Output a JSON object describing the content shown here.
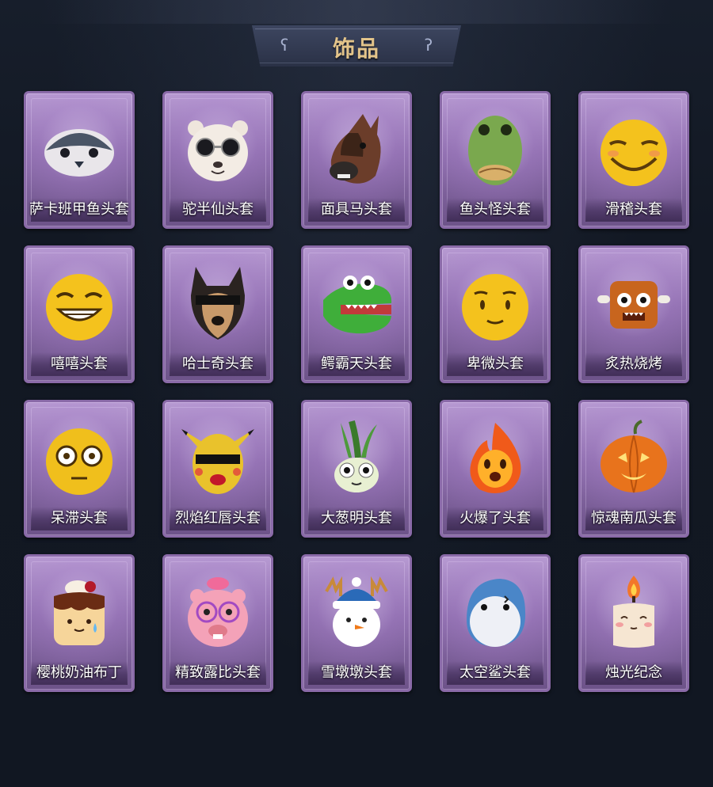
{
  "header": {
    "title": "饰品"
  },
  "items": [
    {
      "label": "萨卡班甲鱼头套",
      "icon": "fish-head-mask-icon"
    },
    {
      "label": "驼半仙头套",
      "icon": "alpaca-sunglasses-mask-icon"
    },
    {
      "label": "面具马头套",
      "icon": "horse-head-mask-icon"
    },
    {
      "label": "鱼头怪头套",
      "icon": "green-fish-head-mask-icon"
    },
    {
      "label": "滑稽头套",
      "icon": "funny-face-mask-icon"
    },
    {
      "label": "嘻嘻头套",
      "icon": "grinning-face-mask-icon"
    },
    {
      "label": "哈士奇头套",
      "icon": "husky-mask-icon"
    },
    {
      "label": "鳄霸天头套",
      "icon": "crocodile-mask-icon"
    },
    {
      "label": "卑微头套",
      "icon": "humble-face-mask-icon"
    },
    {
      "label": "炙热烧烤",
      "icon": "barbecue-mask-icon"
    },
    {
      "label": "呆滞头套",
      "icon": "dazed-face-mask-icon"
    },
    {
      "label": "烈焰红唇头套",
      "icon": "pikachu-lips-mask-icon"
    },
    {
      "label": "大葱明头套",
      "icon": "scallion-mask-icon"
    },
    {
      "label": "火爆了头套",
      "icon": "fire-mask-icon"
    },
    {
      "label": "惊魂南瓜头套",
      "icon": "pumpkin-mask-icon"
    },
    {
      "label": "樱桃奶油布丁",
      "icon": "pudding-mask-icon"
    },
    {
      "label": "精致露比头套",
      "icon": "loopy-mask-icon"
    },
    {
      "label": "雪墩墩头套",
      "icon": "snowman-mask-icon"
    },
    {
      "label": "太空鲨头套",
      "icon": "space-shark-mask-icon"
    },
    {
      "label": "烛光纪念",
      "icon": "candle-mask-icon"
    }
  ],
  "colors": {
    "background": "#121823",
    "card_frame": "#8a6aa8",
    "title_gold": "#e3c48a"
  }
}
